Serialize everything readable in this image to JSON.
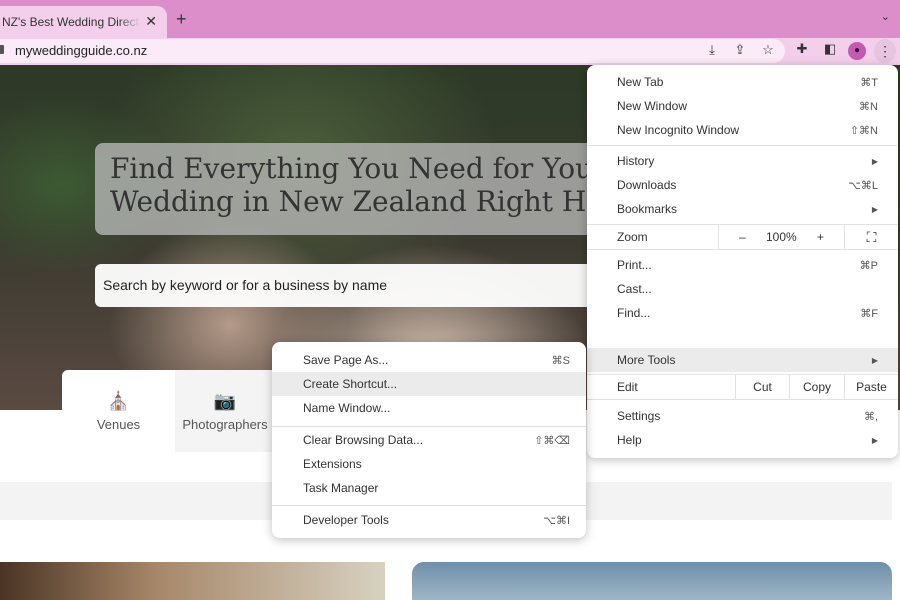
{
  "browser": {
    "tab_title": "NZ's Best Wedding Directory and Planning",
    "url": "myweddingguide.co.nz",
    "theme_color": "#dc8ecb"
  },
  "hero": {
    "title_line1": "Find Everything You Need for Your",
    "title_line2": "Wedding in New Zealand Right Here",
    "search_placeholder": "Search by keyword or for a business by name"
  },
  "categories": [
    {
      "label": "Venues",
      "icon": "venue-icon"
    },
    {
      "label": "Photographers",
      "icon": "camera-icon"
    }
  ],
  "main_menu": {
    "items": [
      {
        "label": "New Tab",
        "shortcut": "⌘T"
      },
      {
        "label": "New Window",
        "shortcut": "⌘N"
      },
      {
        "label": "New Incognito Window",
        "shortcut": "⇧⌘N"
      },
      {
        "label": "History",
        "submenu": true
      },
      {
        "label": "Downloads",
        "shortcut": "⌥⌘L"
      },
      {
        "label": "Bookmarks",
        "submenu": true
      },
      {
        "label": "Print...",
        "shortcut": "⌘P"
      },
      {
        "label": "Cast..."
      },
      {
        "label": "Find...",
        "shortcut": "⌘F"
      },
      {
        "label": "More Tools",
        "submenu": true,
        "highlighted": true
      },
      {
        "label": "Settings",
        "shortcut": "⌘,"
      },
      {
        "label": "Help",
        "submenu": true
      }
    ],
    "zoom": {
      "label": "Zoom",
      "minus": "–",
      "value": "100%",
      "plus": "+"
    },
    "edit": {
      "label": "Edit",
      "cut": "Cut",
      "copy": "Copy",
      "paste": "Paste"
    }
  },
  "more_tools_menu": {
    "items": [
      {
        "label": "Save Page As...",
        "shortcut": "⌘S"
      },
      {
        "label": "Create Shortcut...",
        "highlighted": true
      },
      {
        "label": "Name Window..."
      },
      {
        "label": "Clear Browsing Data...",
        "shortcut": "⇧⌘⌫"
      },
      {
        "label": "Extensions"
      },
      {
        "label": "Task Manager"
      },
      {
        "label": "Developer Tools",
        "shortcut": "⌥⌘I"
      }
    ]
  }
}
